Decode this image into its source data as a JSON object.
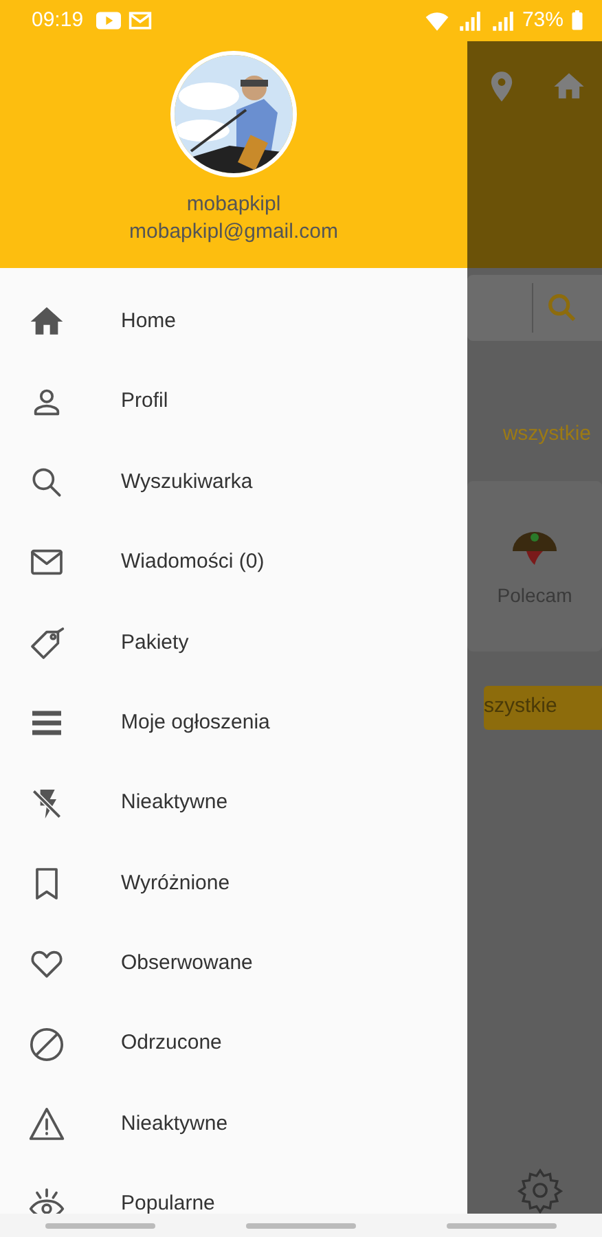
{
  "status_bar": {
    "time": "09:19",
    "battery": "73%"
  },
  "drawer": {
    "user_name": "mobapkipl",
    "email": "mobapkipl@gmail.com",
    "items": [
      {
        "label": "Home"
      },
      {
        "label": "Profil"
      },
      {
        "label": "Wyszukiwarka"
      },
      {
        "label": "Wiadomości (0)"
      },
      {
        "label": "Pakiety"
      },
      {
        "label": "Moje ogłoszenia"
      },
      {
        "label": "Nieaktywne"
      },
      {
        "label": "Wyróżnione"
      },
      {
        "label": "Obserwowane"
      },
      {
        "label": "Odrzucone"
      },
      {
        "label": "Nieaktywne"
      },
      {
        "label": "Popularne"
      }
    ]
  },
  "background_screen": {
    "link": "wszystkie",
    "card_label": "Polecam",
    "button": "szystkie"
  }
}
